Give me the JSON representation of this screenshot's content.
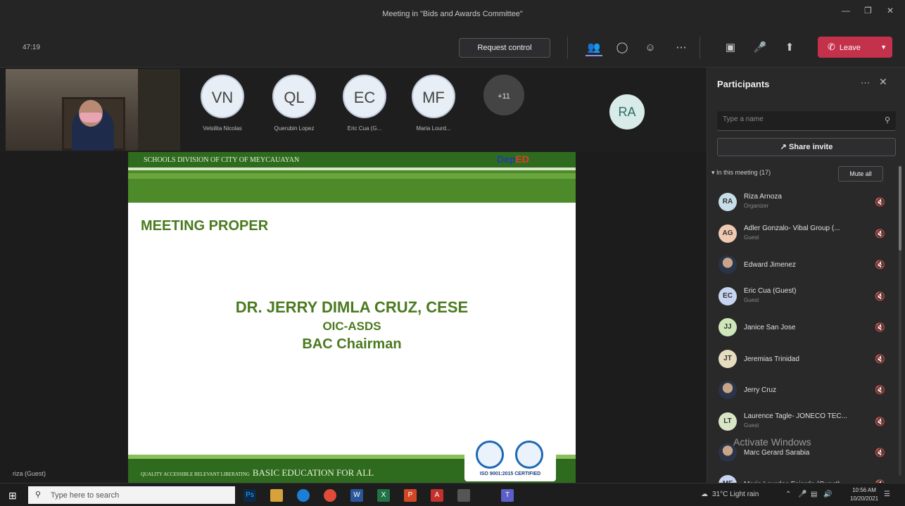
{
  "window": {
    "title": "Meeting in \"Bids and Awards Committee\"",
    "minimize": "—",
    "restore": "❐",
    "close": "✕"
  },
  "toolbar": {
    "timer": "47:19",
    "request_control": "Request control",
    "leave_label": "Leave",
    "icons": [
      "participants-icon",
      "chat-icon",
      "reactions-icon",
      "more-icon",
      "camera-off-icon",
      "mic-off-icon",
      "share-icon"
    ]
  },
  "strip": {
    "avatars": [
      {
        "initials": "VN",
        "name": "Velsilita Nicolas"
      },
      {
        "initials": "QL",
        "name": "Querubin Lopez"
      },
      {
        "initials": "EC",
        "name": "Eric Cua (G..."
      },
      {
        "initials": "MF",
        "name": "Maria Lourd..."
      }
    ],
    "more_count": "+11",
    "speaker_initials": "RA"
  },
  "slide": {
    "org": "SCHOOLS DIVISION OF CITY OF MEYCAUAYAN",
    "logo_a": "Dep",
    "logo_b": "ED",
    "heading": "MEETING PROPER",
    "line1": "DR. JERRY DIMLA CRUZ, CESE",
    "line2": "OIC-ASDS",
    "line3": "BAC Chairman",
    "footer_small": "QUALITY ACCESSIBLE RELEVANT LIBERATING",
    "footer_main": "BASIC EDUCATION FOR ALL",
    "cert": "ISO 9001:2015 CERTIFIED"
  },
  "self_label": "riza (Guest)",
  "panel": {
    "title": "Participants",
    "search_placeholder": "Type a name",
    "share_invite": "Share invite",
    "section": "In this meeting (17)",
    "mute_all": "Mute all",
    "participants": [
      {
        "initials": "RA",
        "name": "Riza Arnoza",
        "role": "Organizer",
        "color": "#c7dde8",
        "photo": false
      },
      {
        "initials": "AG",
        "name": "Adler Gonzalo- Vibal Group (...",
        "role": "Guest",
        "color": "#f0c9b3",
        "photo": false
      },
      {
        "initials": "",
        "name": "Edward Jimenez",
        "role": "",
        "color": "",
        "photo": true
      },
      {
        "initials": "EC",
        "name": "Eric Cua (Guest)",
        "role": "Guest",
        "color": "#c7d4f0",
        "photo": false
      },
      {
        "initials": "JJ",
        "name": "Janice San Jose",
        "role": "",
        "color": "#cfe6b8",
        "photo": false
      },
      {
        "initials": "JT",
        "name": "Jeremias Trinidad",
        "role": "",
        "color": "#e6ddc0",
        "photo": false
      },
      {
        "initials": "",
        "name": "Jerry Cruz",
        "role": "",
        "color": "",
        "photo": true
      },
      {
        "initials": "LT",
        "name": "Laurence Tagle- JONECO TEC...",
        "role": "Guest",
        "color": "#d9e6c6",
        "photo": false
      },
      {
        "initials": "",
        "name": "Marc Gerard Sarabia",
        "role": "",
        "color": "",
        "photo": true
      },
      {
        "initials": "MF",
        "name": "Maria Lourdes Fajardo (Guest)",
        "role": "",
        "color": "#c7d4f0",
        "photo": false
      }
    ],
    "watermark": "Activate Windows"
  },
  "taskbar": {
    "search_placeholder": "Type here to search",
    "weather": "31°C  Light rain",
    "time": "10:56 AM",
    "date": "10/20/2021"
  }
}
